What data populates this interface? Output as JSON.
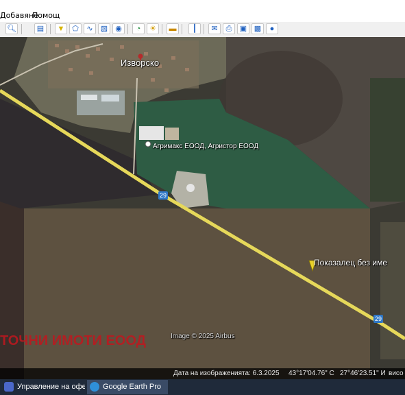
{
  "menu": {
    "items": [
      {
        "label": "Добавяне",
        "access": "Д"
      },
      {
        "label": "Помощ",
        "access": "П"
      }
    ]
  },
  "toolbar": {
    "buttons": [
      {
        "icon": "sidebar-toggle-icon"
      },
      {
        "icon": "sidebar-panel-icon"
      },
      {
        "icon": "placemark-icon"
      },
      {
        "icon": "polygon-icon"
      },
      {
        "icon": "path-icon"
      },
      {
        "icon": "image-overlay-icon"
      },
      {
        "icon": "record-tour-icon"
      },
      {
        "icon": "historical-imagery-icon"
      },
      {
        "icon": "sunlight-icon"
      },
      {
        "icon": "switch-planet-icon"
      },
      {
        "icon": "ruler-icon"
      },
      {
        "icon": "email-icon"
      },
      {
        "icon": "print-icon"
      },
      {
        "icon": "save-image-icon"
      },
      {
        "icon": "view-in-maps-icon"
      },
      {
        "icon": "earth-gallery-icon"
      }
    ]
  },
  "map": {
    "labels": {
      "village": "Изворско",
      "business": "Агримакс ЕООД, Агристор ЕООД",
      "placemark": "Показалец без име",
      "road_shield_1": "29",
      "road_shield_2": "29",
      "copyright": "Image © 2025 Airbus",
      "watermark": "ТОЧНИ ИМОТИ ЕООД"
    }
  },
  "status": {
    "date_label": "Дата на изображенията: 6.3.2025",
    "lat": "43°17'04.76\" С",
    "lon": "27°46'23.51\" И",
    "elev": "висо"
  },
  "taskbar": {
    "tasks": [
      {
        "label": "Управление на офер...",
        "icon_color": "#4a67c8"
      },
      {
        "label": "Google Earth Pro",
        "icon_color": "#2f8fd8"
      }
    ]
  },
  "colors": {
    "road": "#e6d85a",
    "field_green": "#2d5a3d",
    "field_brown": "#5a4e3a",
    "watermark": "#c0171f"
  }
}
